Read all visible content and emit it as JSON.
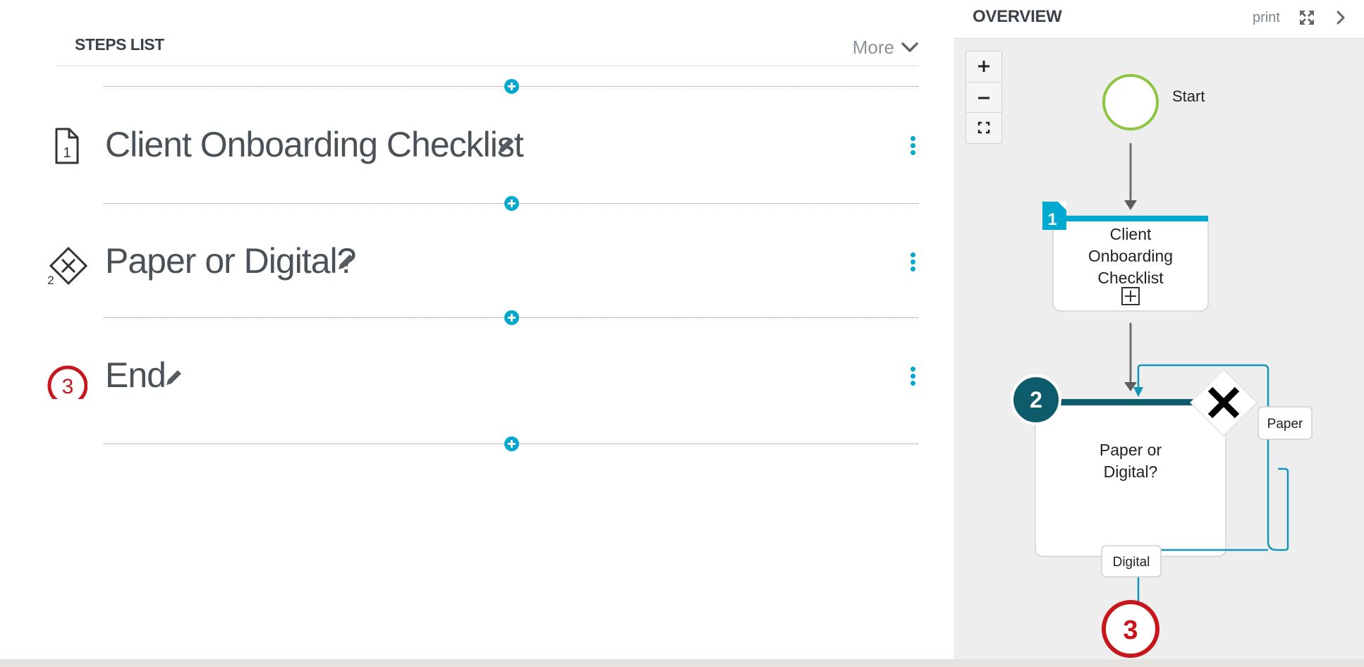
{
  "steps_panel": {
    "title": "STEPS LIST",
    "more_label": "More",
    "steps": [
      {
        "number": "1",
        "title": "Client Onboarding Checklist",
        "type": "document"
      },
      {
        "number": "2",
        "title": "Paper or Digital?",
        "type": "decision"
      },
      {
        "number": "3",
        "title": "End",
        "type": "end"
      }
    ]
  },
  "overview": {
    "title": "OVERVIEW",
    "print_label": "print",
    "zoom_in_label": "+",
    "zoom_out_label": "−",
    "fit_icon": "fit-to-screen-icon",
    "diagram": {
      "start_label": "Start",
      "task": {
        "number": "1",
        "lines": [
          "Client",
          "Onboarding",
          "Checklist"
        ]
      },
      "decision": {
        "number": "2",
        "lines": [
          "Paper or",
          "Digital?"
        ]
      },
      "branch_paper": "Paper",
      "branch_digital": "Digital",
      "end_number": "3"
    }
  },
  "colors": {
    "accent": "#00a9cf",
    "start_green": "#8cc63f",
    "end_red": "#c8161d",
    "decision_teal": "#0e5c6b"
  }
}
